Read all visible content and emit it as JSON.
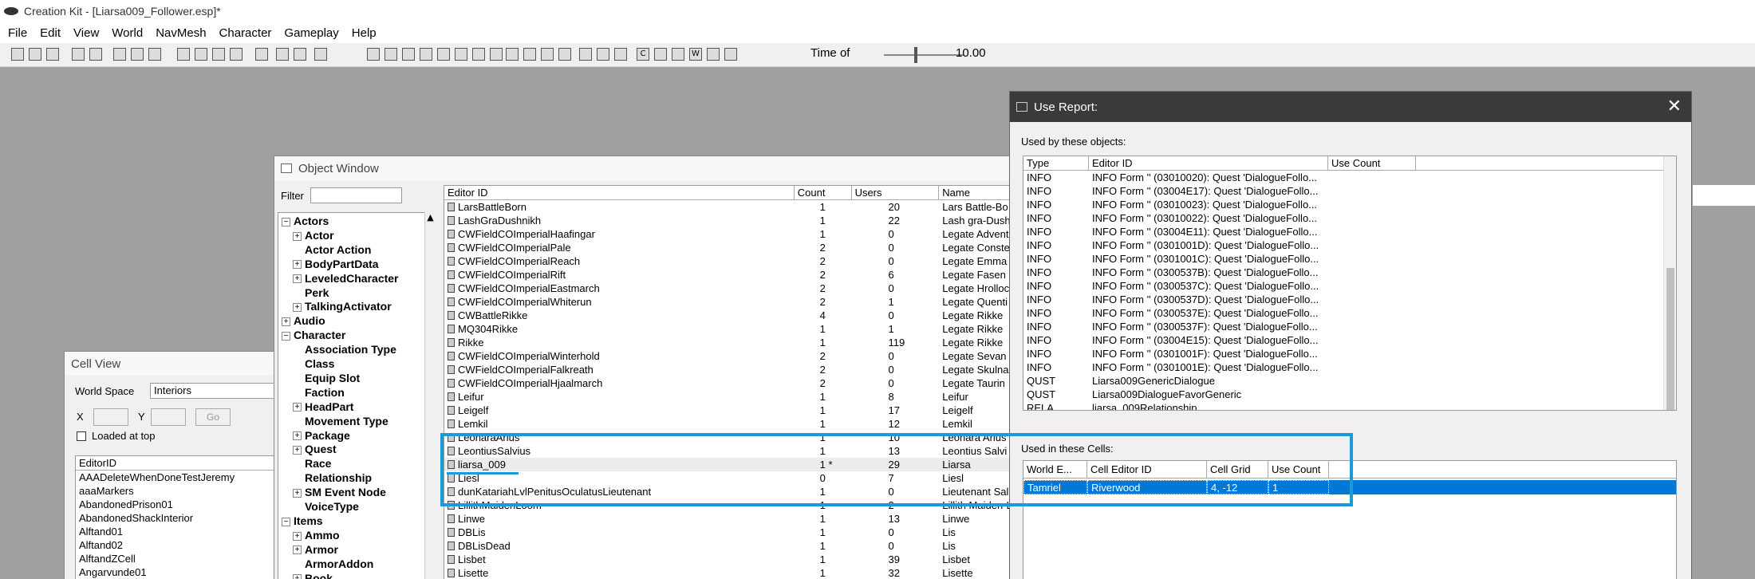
{
  "app": {
    "title": "Creation Kit - [Liarsa009_Follower.esp]*"
  },
  "menu": [
    "File",
    "Edit",
    "View",
    "World",
    "NavMesh",
    "Character",
    "Gameplay",
    "Help"
  ],
  "toolbar": {
    "time_label": "Time of",
    "time_value": "10.00",
    "icon_letters": [
      "C",
      "W"
    ]
  },
  "cell_view": {
    "title": "Cell View",
    "world_space_label": "World Space",
    "world_space_value": "Interiors",
    "x_label": "X",
    "y_label": "Y",
    "go_label": "Go",
    "loaded_at_top_label": "Loaded at top",
    "column": "EditorID",
    "rows": [
      "AAADeleteWhenDoneTestJeremy",
      "aaaMarkers",
      "AbandonedPrison01",
      "AbandonedShackInterior",
      "Alftand01",
      "Alftand02",
      "AlftandZCell",
      "Angarvunde01"
    ]
  },
  "object_window": {
    "title": "Object Window",
    "filter_label": "Filter",
    "filter_value": "",
    "tree": [
      {
        "label": "Actors",
        "exp": "−",
        "lvl": 0
      },
      {
        "label": "Actor",
        "exp": "+",
        "lvl": 1
      },
      {
        "label": "Actor Action",
        "exp": "",
        "lvl": 1
      },
      {
        "label": "BodyPartData",
        "exp": "+",
        "lvl": 1
      },
      {
        "label": "LeveledCharacter",
        "exp": "+",
        "lvl": 1
      },
      {
        "label": "Perk",
        "exp": "",
        "lvl": 1
      },
      {
        "label": "TalkingActivator",
        "exp": "+",
        "lvl": 1
      },
      {
        "label": "Audio",
        "exp": "+",
        "lvl": 0
      },
      {
        "label": "Character",
        "exp": "−",
        "lvl": 0
      },
      {
        "label": "Association Type",
        "exp": "",
        "lvl": 1
      },
      {
        "label": "Class",
        "exp": "",
        "lvl": 1
      },
      {
        "label": "Equip Slot",
        "exp": "",
        "lvl": 1
      },
      {
        "label": "Faction",
        "exp": "",
        "lvl": 1
      },
      {
        "label": "HeadPart",
        "exp": "+",
        "lvl": 1
      },
      {
        "label": "Movement Type",
        "exp": "",
        "lvl": 1
      },
      {
        "label": "Package",
        "exp": "+",
        "lvl": 1
      },
      {
        "label": "Quest",
        "exp": "+",
        "lvl": 1
      },
      {
        "label": "Race",
        "exp": "",
        "lvl": 1
      },
      {
        "label": "Relationship",
        "exp": "",
        "lvl": 1
      },
      {
        "label": "SM Event Node",
        "exp": "+",
        "lvl": 1
      },
      {
        "label": "VoiceType",
        "exp": "",
        "lvl": 1
      },
      {
        "label": "Items",
        "exp": "−",
        "lvl": 0
      },
      {
        "label": "Ammo",
        "exp": "+",
        "lvl": 1
      },
      {
        "label": "Armor",
        "exp": "+",
        "lvl": 1
      },
      {
        "label": "ArmorAddon",
        "exp": "",
        "lvl": 1
      },
      {
        "label": "Book",
        "exp": "+",
        "lvl": 1
      }
    ],
    "columns": [
      "Editor ID",
      "Count",
      "Users",
      "Name"
    ],
    "rows": [
      [
        "LarsBattleBorn",
        "1",
        "20",
        "Lars Battle-Bo"
      ],
      [
        "LashGraDushnikh",
        "1",
        "22",
        "Lash gra-Dush"
      ],
      [
        "CWFieldCOImperialHaafingar",
        "1",
        "0",
        "Legate Advent"
      ],
      [
        "CWFieldCOImperialPale",
        "2",
        "0",
        "Legate Conste"
      ],
      [
        "CWFieldCOImperialReach",
        "2",
        "0",
        "Legate Emma"
      ],
      [
        "CWFieldCOImperialRift",
        "2",
        "6",
        "Legate Fasen"
      ],
      [
        "CWFieldCOImperialEastmarch",
        "2",
        "0",
        "Legate Hrolloc"
      ],
      [
        "CWFieldCOImperialWhiterun",
        "2",
        "1",
        "Legate Quenti"
      ],
      [
        "CWBattleRikke",
        "4",
        "0",
        "Legate Rikke"
      ],
      [
        "MQ304Rikke",
        "1",
        "1",
        "Legate Rikke"
      ],
      [
        "Rikke",
        "1",
        "119",
        "Legate Rikke"
      ],
      [
        "CWFieldCOImperialWinterhold",
        "2",
        "0",
        "Legate Sevan"
      ],
      [
        "CWFieldCOImperialFalkreath",
        "2",
        "0",
        "Legate Skulna"
      ],
      [
        "CWFieldCOImperialHjaalmarch",
        "2",
        "0",
        "Legate Taurin"
      ],
      [
        "Leifur",
        "1",
        "8",
        "Leifur"
      ],
      [
        "Leigelf",
        "1",
        "17",
        "Leigelf"
      ],
      [
        "Lemkil",
        "1",
        "12",
        "Lemkil"
      ],
      [
        "LeonaraArius",
        "1",
        "10",
        "Leonara Arius"
      ],
      [
        "LeontiusSalvius",
        "1",
        "13",
        "Leontius Salvi"
      ],
      [
        "liarsa_009",
        "1 *",
        "29",
        "Liarsa"
      ],
      [
        "Liesl",
        "0",
        "7",
        "Liesl"
      ],
      [
        "dunKatariahLvlPenitusOculatusLieutenant",
        "1",
        "0",
        "Lieutenant Sal"
      ],
      [
        "LillithMaidenLoom",
        "1",
        "2",
        "Lillith Maiden-L"
      ],
      [
        "Linwe",
        "1",
        "13",
        "Linwe"
      ],
      [
        "DBLis",
        "1",
        "0",
        "Lis"
      ],
      [
        "DBLisDead",
        "1",
        "0",
        "Lis"
      ],
      [
        "Lisbet",
        "1",
        "39",
        "Lisbet"
      ],
      [
        "Lisette",
        "1",
        "32",
        "Lisette"
      ]
    ]
  },
  "use_report": {
    "title": "Use Report:",
    "used_by_label": "Used by these objects:",
    "objects_columns": [
      "Type",
      "Editor ID",
      "Use Count"
    ],
    "objects": [
      [
        "INFO",
        "INFO Form '' (03010020): Quest 'DialogueFollo..."
      ],
      [
        "INFO",
        "INFO Form '' (03004E17): Quest 'DialogueFollo..."
      ],
      [
        "INFO",
        "INFO Form '' (03010023): Quest 'DialogueFollo..."
      ],
      [
        "INFO",
        "INFO Form '' (03010022): Quest 'DialogueFollo..."
      ],
      [
        "INFO",
        "INFO Form '' (03004E11): Quest 'DialogueFollo..."
      ],
      [
        "INFO",
        "INFO Form '' (0301001D): Quest 'DialogueFollo..."
      ],
      [
        "INFO",
        "INFO Form '' (0301001C): Quest 'DialogueFollo..."
      ],
      [
        "INFO",
        "INFO Form '' (0300537B): Quest 'DialogueFollo..."
      ],
      [
        "INFO",
        "INFO Form '' (0300537C): Quest 'DialogueFollo..."
      ],
      [
        "INFO",
        "INFO Form '' (0300537D): Quest 'DialogueFollo..."
      ],
      [
        "INFO",
        "INFO Form '' (0300537E): Quest 'DialogueFollo..."
      ],
      [
        "INFO",
        "INFO Form '' (0300537F): Quest 'DialogueFollo..."
      ],
      [
        "INFO",
        "INFO Form '' (03004E15): Quest 'DialogueFollo..."
      ],
      [
        "INFO",
        "INFO Form '' (0301001F): Quest 'DialogueFollo..."
      ],
      [
        "INFO",
        "INFO Form '' (0301001E): Quest 'DialogueFollo..."
      ],
      [
        "QUST",
        "Liarsa009GenericDialogue"
      ],
      [
        "QUST",
        "Liarsa009DialogueFavorGeneric"
      ],
      [
        "RELA",
        "liarsa_009Relationship"
      ]
    ],
    "cells_label": "Used in these Cells:",
    "cells_columns": [
      "World E...",
      "Cell Editor ID",
      "Cell Grid",
      "Use Count"
    ],
    "cells": [
      [
        "Tamriel",
        "Riverwood",
        "4, -12",
        "1"
      ]
    ]
  },
  "colors": {
    "highlight": "#1a9bd7",
    "selection": "#0078d7"
  }
}
